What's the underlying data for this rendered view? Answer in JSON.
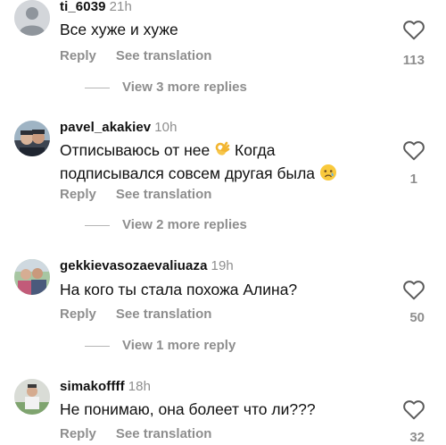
{
  "comments": [
    {
      "username": "ti_6039",
      "time": "21h",
      "text": "Все хуже и хуже",
      "reply_label": "Reply",
      "translation_label": "See translation",
      "likes": "113",
      "view_more": "View 3 more replies",
      "avatar": "default-avatar-icon"
    },
    {
      "username": "pavel_akakiev",
      "time": "10h",
      "text_part1": "Отписываюсь от нее",
      "text_part2": "Когда",
      "text_line2": "подписывался совсем другая была",
      "reply_label": "Reply",
      "translation_label": "See translation",
      "likes": "1",
      "view_more": "View 2 more replies",
      "avatar": "photo-avatar"
    },
    {
      "username": "gekkievasozaevaliuaza",
      "time": "19h",
      "text": "На кого ты стала похожа Алина?",
      "reply_label": "Reply",
      "translation_label": "See translation",
      "likes": "50",
      "view_more": "View 1 more reply",
      "avatar": "photo-avatar"
    },
    {
      "username": "simakoffff",
      "time": "18h",
      "text": "Не понимаю, она болеет что ли???",
      "reply_label": "Reply",
      "translation_label": "See translation",
      "likes": "32",
      "avatar": "photo-avatar"
    }
  ],
  "icons": {
    "like": "heart-outline-icon",
    "ok_emoji": "ok-hand-emoji",
    "sad_emoji": "crying-face-emoji"
  },
  "colors": {
    "text": "#111111",
    "secondary": "#8e8e8e",
    "background": "#ffffff"
  }
}
